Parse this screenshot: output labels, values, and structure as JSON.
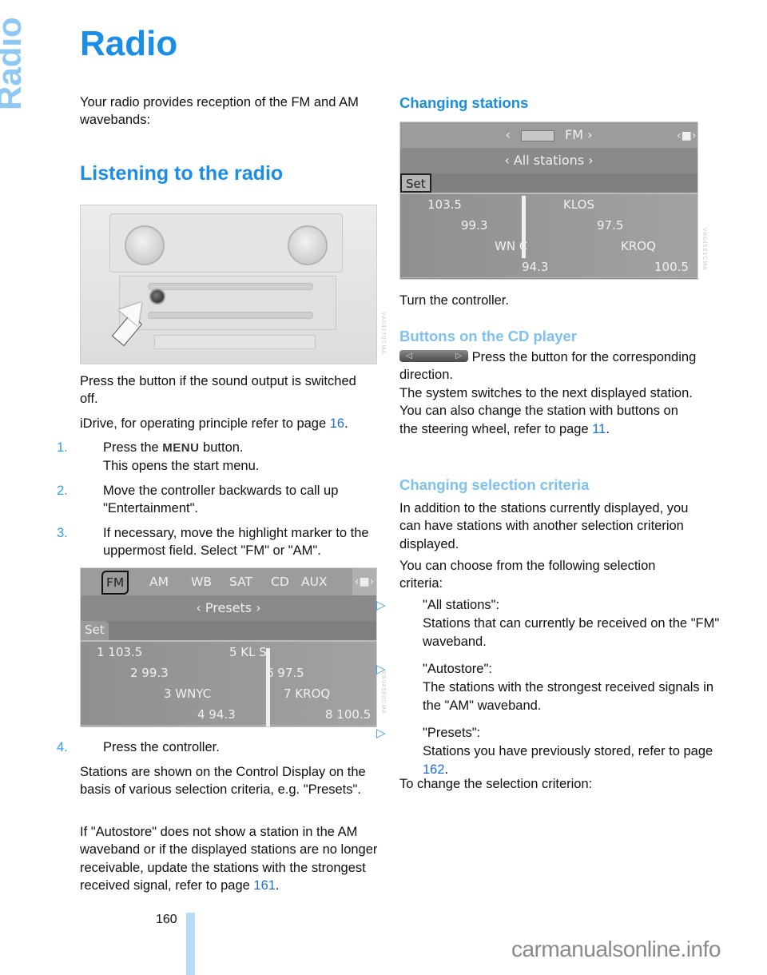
{
  "side_label": "Radio",
  "title": "Radio",
  "intro": "Your radio provides reception of the FM and AM wavebands:",
  "section_listening": {
    "heading": "Listening to the radio",
    "photo_code": "VA04170CMA",
    "press_button_text": "Press the button if the sound output is switched off.",
    "idrive_text": "iDrive, for operating principle refer to page ",
    "idrive_page": "16",
    "steps": [
      {
        "num": "1.",
        "before": "Press the ",
        "key": "MENU",
        "after": " button.",
        "line2": "This opens the start menu."
      },
      {
        "num": "2.",
        "text": "Move the controller backwards to call up \"Entertainment\"."
      },
      {
        "num": "3.",
        "text": "If necessary, move the highlight marker to the uppermost field. Select \"FM\" or \"AM\"."
      },
      {
        "num": "4.",
        "text": "Press the controller."
      }
    ],
    "screen_presets": {
      "bands": [
        "FM",
        "AM",
        "WB",
        "SAT",
        "CD",
        "AUX"
      ],
      "active_band": "FM",
      "criterion": "‹ Presets ›",
      "set_label": "Set",
      "rows": [
        {
          "left": "1 103.5",
          "mid": "5 KL S",
          "right": ""
        },
        {
          "left": "2 99.3",
          "mid": "",
          "right": "6 97.5"
        },
        {
          "left": "3 WNYC",
          "mid": "",
          "right": "7 KROQ"
        },
        {
          "left": "4 94.3",
          "mid": "",
          "right": "8 100.5"
        }
      ],
      "code": "VA04560CMA"
    },
    "stations_text": "Stations are shown on the Control Display on the basis of various selection criteria, e.g. \"Presets\".",
    "autostore_text": "If \"Autostore\" does not show a station in the AM waveband or if the displayed stations are no longer receivable, update the stations with the strongest received signal, refer to page ",
    "autostore_page": "161"
  },
  "section_changing": {
    "heading": "Changing stations",
    "screen_all": {
      "top_label": "FM",
      "criterion": "‹ All stations ›",
      "set_label": "Set",
      "rows": [
        {
          "left": "103.5",
          "right": "KLOS"
        },
        {
          "left": "99.3",
          "right": "97.5"
        },
        {
          "left": "WN C",
          "right": "KROQ"
        },
        {
          "left": "94.3",
          "right": "100.5"
        }
      ],
      "code": "VA04561CMA"
    },
    "turn_text": "Turn the controller.",
    "cd_heading": "Buttons on the CD player",
    "cd_text1": " Press the button for the corresponding direction.",
    "cd_text2": "The system switches to the next displayed station.",
    "cd_text3": "You can also change the station with buttons on the steering wheel, refer to page ",
    "cd_page": "11",
    "criteria_heading": "Changing selection criteria",
    "criteria_intro": "In addition to the stations currently displayed, you can have stations with another selection criterion displayed.",
    "criteria_choose": "You can choose from the following selection criteria:",
    "criteria": [
      {
        "name": "\"All stations\":",
        "desc": "Stations that can currently be received on the \"FM\" waveband."
      },
      {
        "name": "\"Autostore\":",
        "desc": "The stations with the strongest received signals in the \"AM\" waveband."
      },
      {
        "name": "\"Presets\":",
        "desc": "Stations you have previously stored, refer to page ",
        "page": "162"
      }
    ],
    "to_change": "To change the selection criterion:"
  },
  "footer": {
    "page_number": "160",
    "watermark": "carmanualsonline.info"
  },
  "colors": {
    "heading_blue": "#1a8ee6",
    "light_blue": "#8fc8f5",
    "link_blue": "#1a6fe0"
  }
}
